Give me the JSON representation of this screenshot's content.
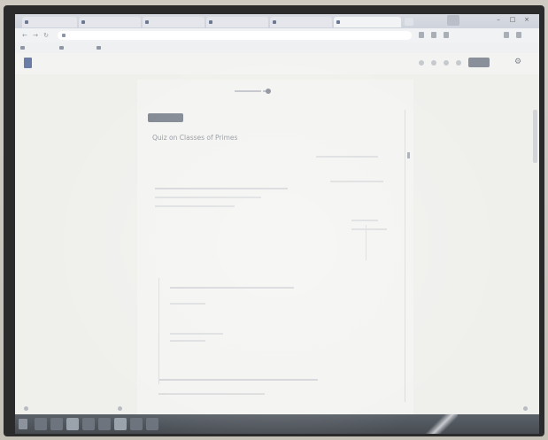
{
  "browser": {
    "tabs": [
      {
        "title": "",
        "active": false
      },
      {
        "title": "",
        "active": false
      },
      {
        "title": "",
        "active": false
      },
      {
        "title": "",
        "active": false
      },
      {
        "title": "",
        "active": false
      },
      {
        "title": "",
        "active": true
      }
    ],
    "address": "",
    "bookmarks": [
      "",
      "",
      ""
    ]
  },
  "app": {
    "doc_title": "",
    "share_label": ""
  },
  "document": {
    "badge_label": "",
    "heading": "Quiz on Classes of Primes"
  },
  "icons": {
    "settings": "gear-icon",
    "back": "back-arrow-icon",
    "forward": "forward-arrow-icon",
    "reload": "reload-icon",
    "doc_logo": "docs-logo-icon",
    "start": "start-menu-icon"
  },
  "colors": {
    "taskbar": "#4e545b",
    "share_button": "#8a9099",
    "badge": "#7e858f",
    "screen_bg": "#ecece9"
  }
}
